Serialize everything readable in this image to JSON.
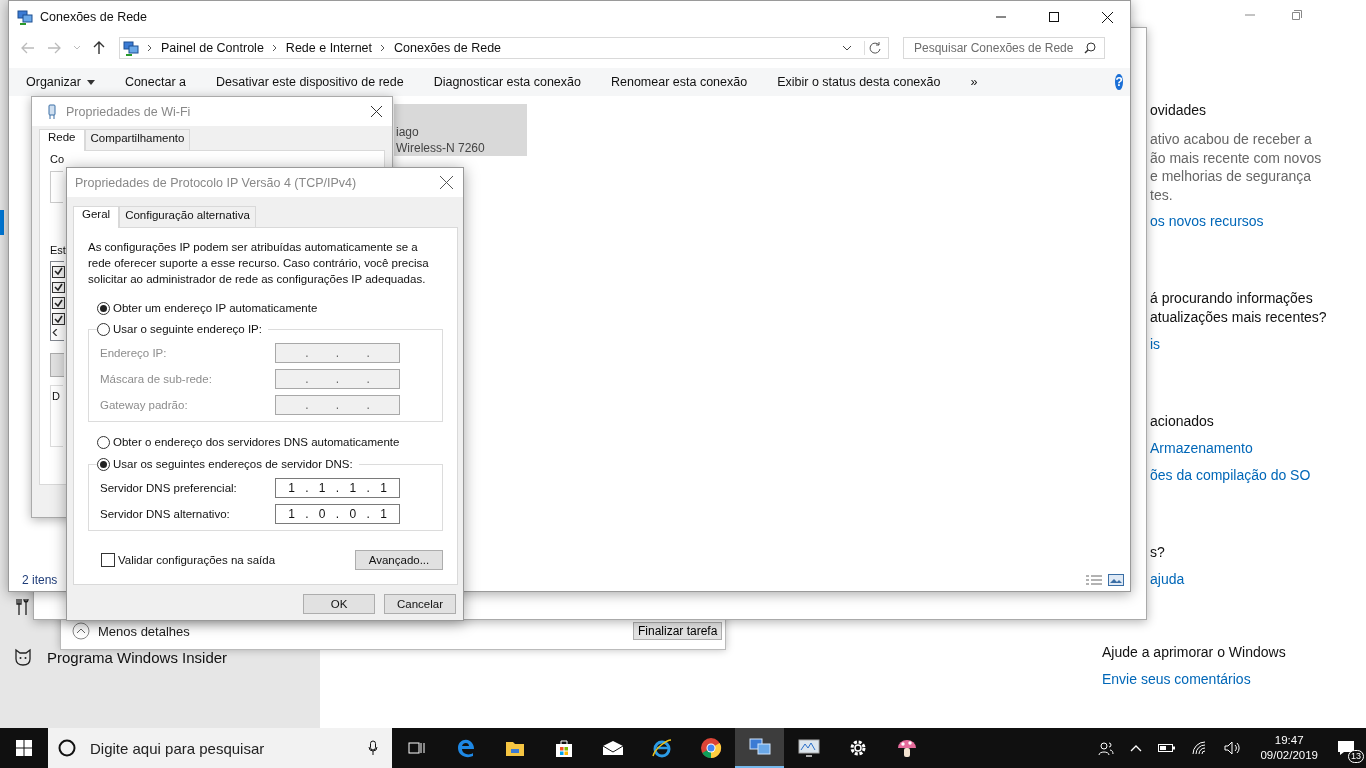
{
  "settings_window": {
    "nav_items": [
      {
        "label": "Programa Windows Insider"
      }
    ],
    "sections": [
      {
        "items": [
          {
            "kind": "heading",
            "text": "ovidades"
          },
          {
            "kind": "body",
            "text": "ativo acabou de receber a\não mais recente com novos\ne melhorias de segurança\ntes."
          },
          {
            "kind": "link",
            "text": "os novos recursos"
          }
        ]
      },
      {
        "items": [
          {
            "kind": "heading",
            "text": "á procurando informações\natualizações mais recentes?"
          },
          {
            "kind": "link",
            "text": "is"
          }
        ]
      },
      {
        "items": [
          {
            "kind": "heading",
            "text": "acionados"
          },
          {
            "kind": "link",
            "text": "Armazenamento"
          },
          {
            "kind": "link",
            "text": "ões da compilação do SO"
          }
        ]
      },
      {
        "items": [
          {
            "kind": "heading",
            "text": "s?"
          },
          {
            "kind": "link",
            "text": "ajuda"
          }
        ]
      }
    ],
    "feedback": {
      "heading": "Ajude a aprimorar o Windows",
      "link": "Envie seus comentários"
    }
  },
  "task_window": {
    "details_toggle": "Menos detalhes",
    "end_task_button": "Finalizar tarefa"
  },
  "explorer": {
    "title": "Conexões de Rede",
    "breadcrumb": [
      "Painel de Controle",
      "Rede e Internet",
      "Conexões de Rede"
    ],
    "search": {
      "placeholder": "Pesquisar Conexões de Rede"
    },
    "toolbar": [
      {
        "kind": "menu",
        "label": "Organizar"
      },
      {
        "kind": "command",
        "label": "Conectar a"
      },
      {
        "kind": "command",
        "label": "Desativar este dispositivo de rede"
      },
      {
        "kind": "command",
        "label": "Diagnosticar esta conexão"
      },
      {
        "kind": "command",
        "label": "Renomear esta conexão"
      },
      {
        "kind": "command",
        "label": "Exibir o status desta conexão"
      },
      {
        "kind": "more",
        "label": "»"
      }
    ],
    "help": "?",
    "item": {
      "lines": [
        "iago",
        "Wireless-N 7260"
      ],
      "selected": true
    },
    "status": "2 itens"
  },
  "wifi_window": {
    "title": "Propriedades de Wi-Fi",
    "tabs": [
      {
        "label": "Rede",
        "selected": true
      },
      {
        "label": "Compartilhamento",
        "selected": false
      }
    ],
    "labels": [
      "Co",
      "Est",
      "D"
    ],
    "components": [
      {
        "checked": true
      },
      {
        "checked": true
      },
      {
        "checked": true
      },
      {
        "checked": true
      }
    ]
  },
  "ipv4_dialog": {
    "title": "Propriedades de Protocolo IP Versão 4 (TCP/IPv4)",
    "tabs": [
      {
        "label": "Geral",
        "selected": true
      },
      {
        "label": "Configuração alternativa",
        "selected": false
      }
    ],
    "description": "As configurações IP podem ser atribuídas automaticamente se a rede oferecer suporte a esse recurso. Caso contrário, você precisa solicitar ao administrador de rede as configurações IP adequadas.",
    "ip_auto": {
      "label": "Obter um endereço IP automaticamente",
      "selected": true
    },
    "ip_manual": {
      "label": "Usar o seguinte endereço IP:",
      "selected": false
    },
    "ip_fields": [
      {
        "label": "Endereço IP:",
        "value": ". . .",
        "disabled": true
      },
      {
        "label": "Máscara de sub-rede:",
        "value": ". . .",
        "disabled": true
      },
      {
        "label": "Gateway padrão:",
        "value": ". . .",
        "disabled": true
      }
    ],
    "dns_auto": {
      "label": "Obter o endereço dos servidores DNS automaticamente",
      "selected": false
    },
    "dns_manual": {
      "label": "Usar os seguintes endereços de servidor DNS:",
      "selected": true
    },
    "dns_fields": [
      {
        "label": "Servidor DNS preferencial:",
        "value": "1 . 1 . 1 . 1",
        "disabled": false
      },
      {
        "label": "Servidor DNS alternativo:",
        "value": "1 . 0 . 0 . 1",
        "disabled": false
      }
    ],
    "validate": {
      "label": "Validar configurações na saída",
      "checked": false
    },
    "advanced_button": "Avançado...",
    "ok_button": "OK",
    "cancel_button": "Cancelar"
  },
  "taskbar": {
    "search": {
      "placeholder": "Digite aqui para pesquisar"
    },
    "apps": [
      {
        "kind": "taskview",
        "selected": false
      },
      {
        "kind": "edge",
        "selected": false
      },
      {
        "kind": "folder",
        "selected": false
      },
      {
        "kind": "store",
        "selected": false
      },
      {
        "kind": "mail",
        "selected": false
      },
      {
        "kind": "ie",
        "selected": false
      },
      {
        "kind": "chrome",
        "selected": false
      },
      {
        "kind": "network",
        "selected": true
      },
      {
        "kind": "monitor",
        "selected": false
      },
      {
        "kind": "gear",
        "selected": false
      },
      {
        "kind": "mushroom",
        "selected": false
      }
    ],
    "time": "19:47",
    "date": "09/02/2019",
    "notifications": "13"
  }
}
